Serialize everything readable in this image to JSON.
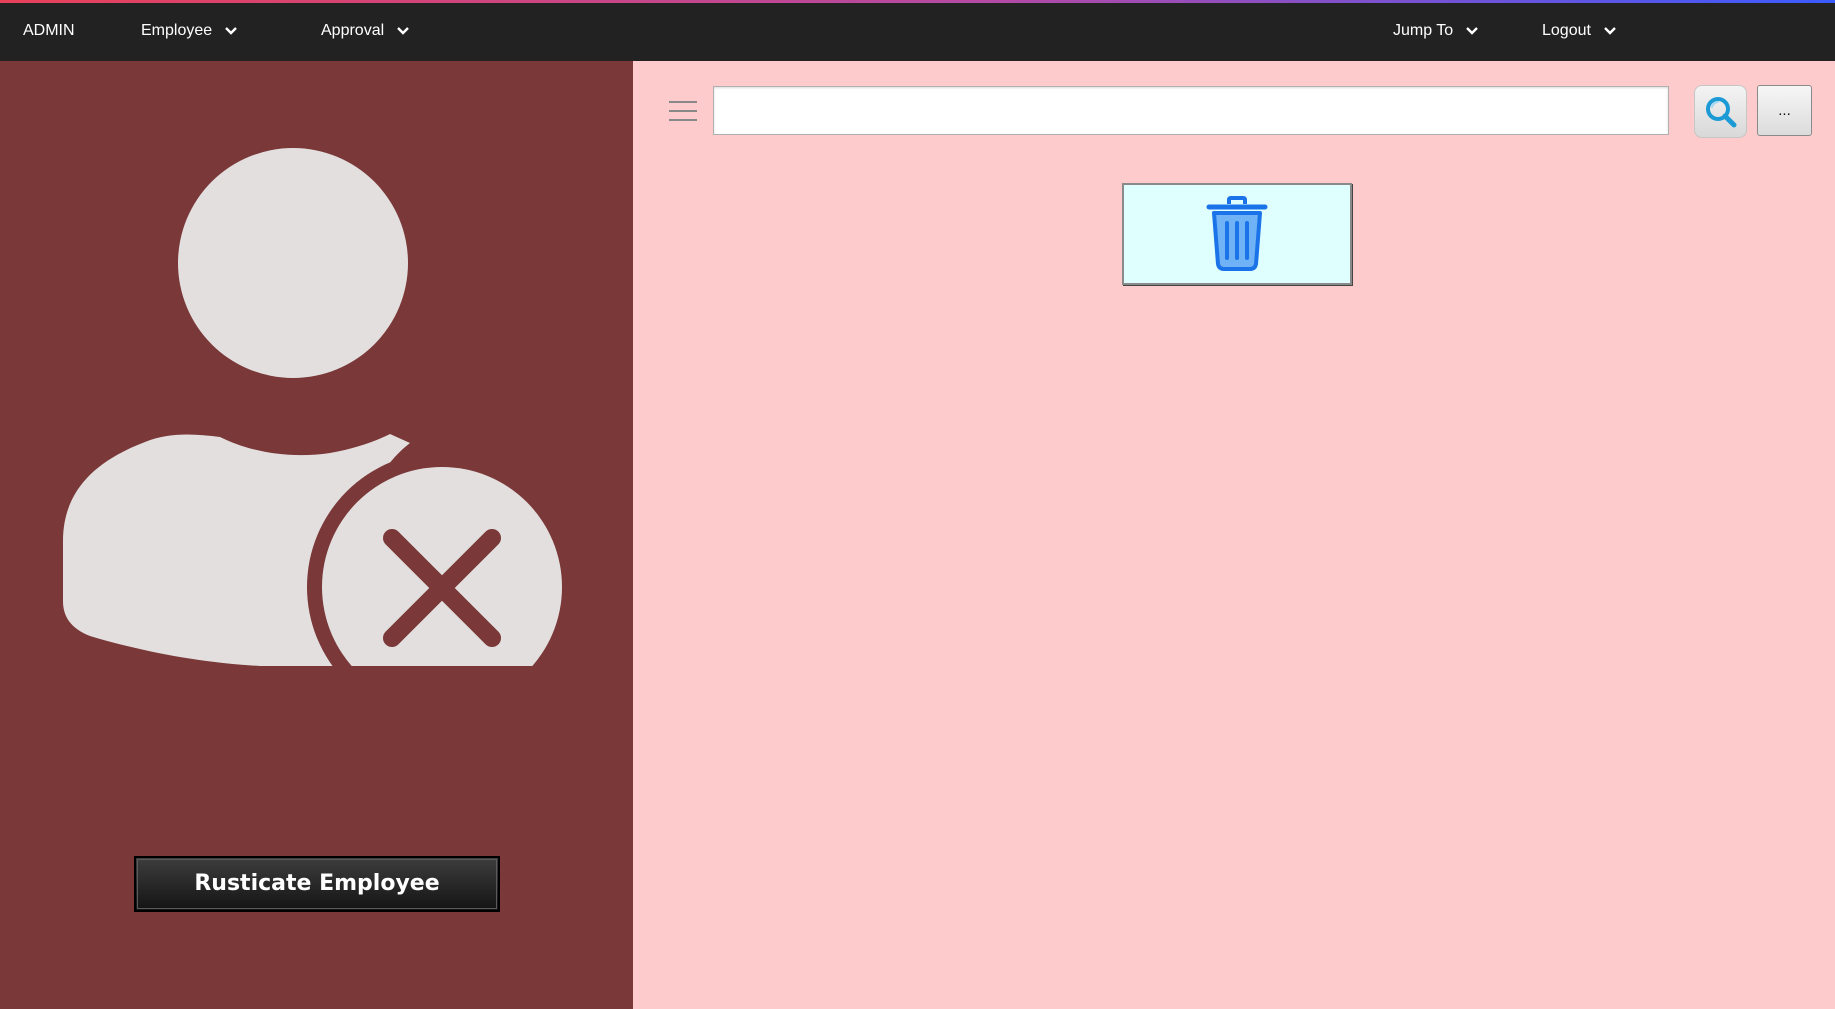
{
  "nav": {
    "brand": "ADMIN",
    "employee": "Employee",
    "approval": "Approval",
    "jump_to": "Jump To",
    "logout": "Logout"
  },
  "left_panel": {
    "avatar_icon": "user-remove-icon",
    "action_label": "Rusticate Employee"
  },
  "toolbar": {
    "search_value": "",
    "more_label": "...",
    "menu_icon": "hamburger-icon",
    "search_icon": "magnifier-icon"
  },
  "main": {
    "delete_icon": "trash-icon"
  },
  "colors": {
    "topbar": "#222222",
    "left_panel": "#7a3838",
    "right_panel": "#fdcbcb",
    "delete_button": "#dfffff",
    "trash_blue": "#1a73e8"
  }
}
